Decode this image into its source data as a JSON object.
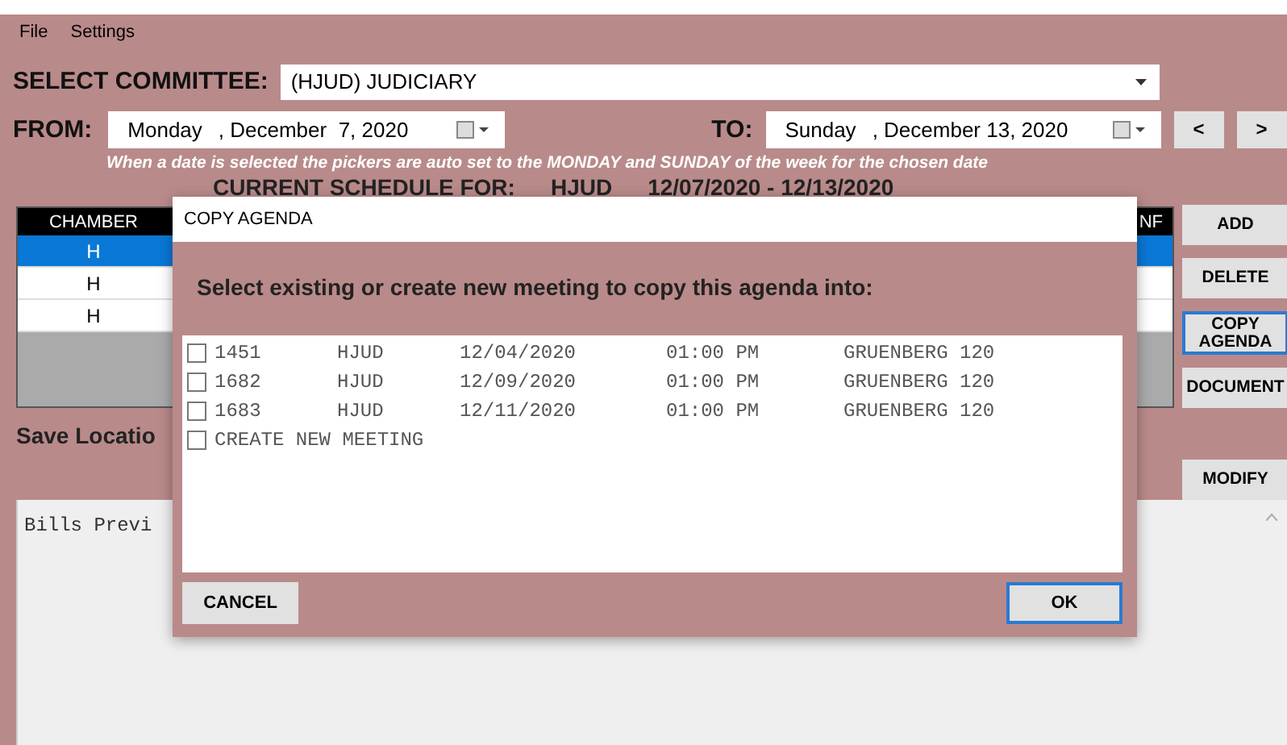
{
  "menu": [
    "File",
    "Settings"
  ],
  "committee": {
    "label": "SELECT COMMITTEE:",
    "value": "(HJUD) JUDICIARY"
  },
  "from": {
    "label": "FROM:",
    "day": "Monday",
    "date": ", December  7, 2020"
  },
  "to": {
    "label": "TO:",
    "day": "Sunday",
    "date": ", December 13, 2020"
  },
  "nav_buttons": [
    "<",
    ">"
  ],
  "hint": "When a date is selected the pickers are auto set to the MONDAY and SUNDAY of the week for the chosen date",
  "schedule": {
    "label": "CURRENT SCHEDULE FOR:",
    "committee": "HJUD",
    "range": "12/07/2020 - 12/13/2020"
  },
  "table": {
    "columns": [
      "CHAMBER",
      "NF"
    ],
    "rows": [
      {
        "chamber": "H",
        "selected": true
      },
      {
        "chamber": "H",
        "selected": false
      },
      {
        "chamber": "H",
        "selected": false
      }
    ]
  },
  "side_buttons": [
    {
      "label": "ADD",
      "focused": false
    },
    {
      "label": "DELETE",
      "focused": false
    },
    {
      "label": "COPY AGENDA",
      "focused": true
    },
    {
      "label": "DOCUMENT",
      "focused": false
    },
    {
      "label": "MODIFY",
      "focused": false
    }
  ],
  "save_location_label": "Save Locatio",
  "bills_preview": "Bills Previ",
  "dialog": {
    "title": "COPY AGENDA",
    "prompt": "Select existing or create new meeting to copy this agenda into:",
    "items": [
      {
        "kind": "meeting",
        "checked": false,
        "id": "1451",
        "committee": "HJUD",
        "date": "12/04/2020",
        "time": "01:00 PM",
        "room": "GRUENBERG 120"
      },
      {
        "kind": "meeting",
        "checked": false,
        "id": "1682",
        "committee": "HJUD",
        "date": "12/09/2020",
        "time": "01:00 PM",
        "room": "GRUENBERG 120"
      },
      {
        "kind": "meeting",
        "checked": false,
        "id": "1683",
        "committee": "HJUD",
        "date": "12/11/2020",
        "time": "01:00 PM",
        "room": "GRUENBERG 120"
      },
      {
        "kind": "create",
        "checked": false,
        "label": "CREATE NEW MEETING"
      }
    ],
    "buttons": [
      {
        "label": "CANCEL",
        "focused": false
      },
      {
        "label": "OK",
        "focused": true
      }
    ]
  }
}
